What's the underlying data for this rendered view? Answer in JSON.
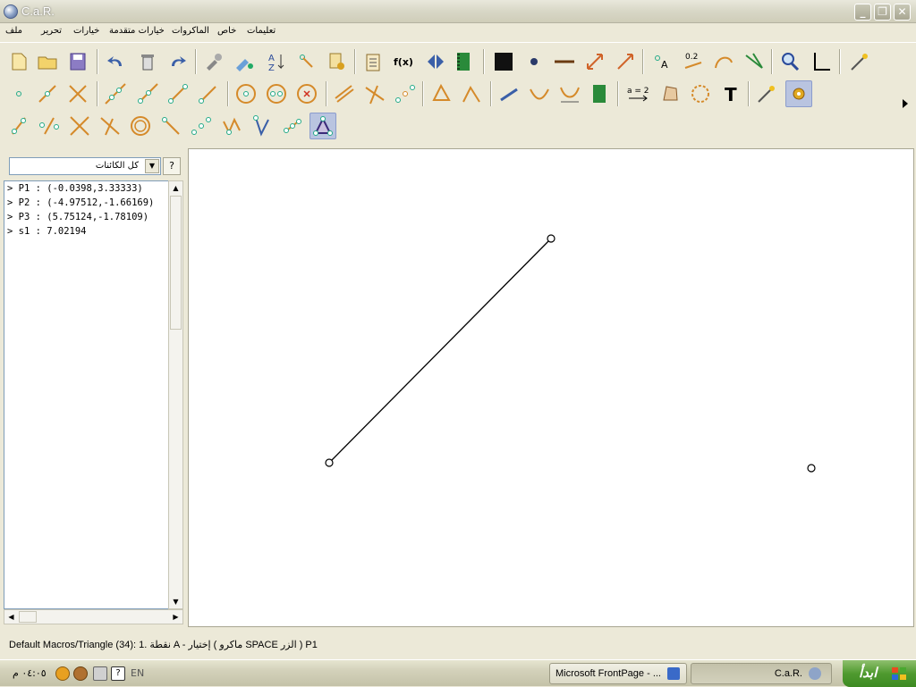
{
  "window": {
    "title": "C.a.R."
  },
  "menu": [
    "ملف",
    "تحرير",
    "خيارات",
    "خيارات متقدمة",
    "الماكروات",
    "خاص",
    "تعليمات"
  ],
  "objects_panel": {
    "filter_value": "كل الكائنات",
    "help_label": "?",
    "items": [
      "> P1 : (-0.0398,3.33333)",
      "> P2 : (-4.97512,-1.66169)",
      "> P3 : (5.75124,-1.78109)",
      "> s1 : 7.02194"
    ]
  },
  "status": {
    "text": "Default Macros/Triangle (34): 1. نقطة A - إختيار ( ماكرو SPACE الزر ) P1"
  },
  "taskbar": {
    "clock": "٠٤:٠٥ م",
    "language": "EN",
    "tasks": [
      "Microsoft FrontPage - ...",
      "C.a.R."
    ],
    "start_label": "ابدأ"
  },
  "colors": {
    "accent_selected": "#b9c4e0",
    "canvas_bg": "#ffffff",
    "start_green": "#4f9a2f"
  }
}
